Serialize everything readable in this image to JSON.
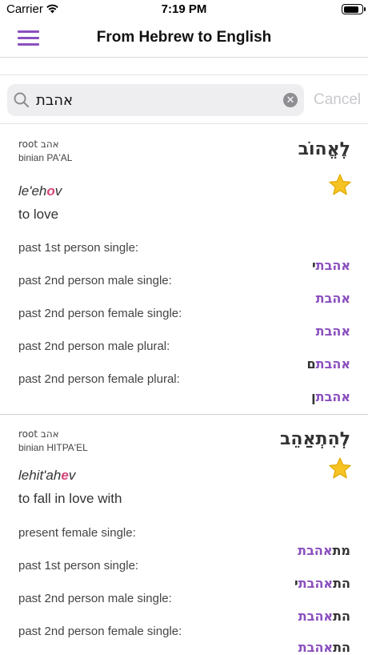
{
  "status_bar": {
    "carrier": "Carrier",
    "time": "7:19 PM",
    "battery_level": 0.9
  },
  "navbar": {
    "title": "From Hebrew to English"
  },
  "search": {
    "query": "אהבת",
    "cancel_label": "Cancel"
  },
  "entries": [
    {
      "root": "root אהב",
      "binian": "binian PA'AL",
      "word": "לֶאֱהוֹב",
      "favorite": true,
      "translit_before": "le'eh",
      "translit_stress": "o",
      "translit_after": "v",
      "meaning": "to love",
      "forms": [
        {
          "label": "past 1st person single:",
          "match": "אהבת",
          "suffix": "י"
        },
        {
          "label": "past 2nd person male single:",
          "match": "אהבת",
          "suffix": ""
        },
        {
          "label": "past 2nd person female single:",
          "match": "אהבת",
          "suffix": ""
        },
        {
          "label": "past 2nd person male plural:",
          "match": "אהבת",
          "suffix": "ם"
        },
        {
          "label": "past 2nd person female plural:",
          "match": "אהבת",
          "suffix": "ן"
        }
      ]
    },
    {
      "root": "root אהב",
      "binian": "binian HITPA'EL",
      "word": "לְהִתְאַהֵב",
      "favorite": true,
      "translit_before": "lehit'ah",
      "translit_stress": "e",
      "translit_after": "v",
      "meaning": "to fall in love with",
      "forms": [
        {
          "label": "present female single:",
          "prefix": "מת",
          "match": "אהבת",
          "suffix": ""
        },
        {
          "label": "past 1st person single:",
          "prefix": "הת",
          "match": "אהבת",
          "suffix": "י"
        },
        {
          "label": "past 2nd person male single:",
          "prefix": "הת",
          "match": "אהבת",
          "suffix": ""
        },
        {
          "label": "past 2nd person female single:",
          "prefix": "הת",
          "match": "אהבת",
          "suffix": ""
        }
      ]
    }
  ]
}
